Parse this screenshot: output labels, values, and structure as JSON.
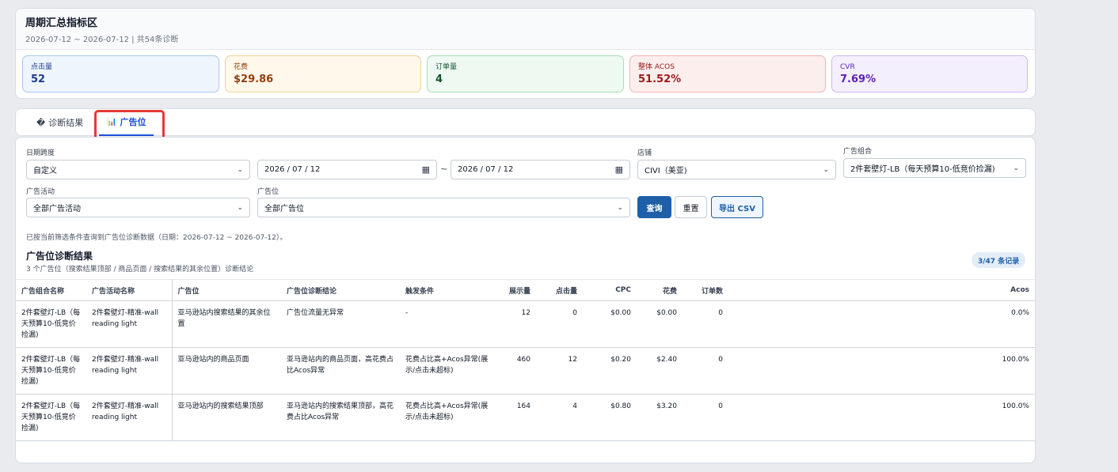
{
  "summary": {
    "title": "周期汇总指标区",
    "subtitle": "2026-07-12 ~ 2026-07-12 | 共54条诊断",
    "kpis": [
      {
        "label": "点击量",
        "value": "52"
      },
      {
        "label": "花费",
        "value": "$29.86"
      },
      {
        "label": "订单量",
        "value": "4"
      },
      {
        "label": "整体 ACOS",
        "value": "51.52%"
      },
      {
        "label": "CVR",
        "value": "7.69%"
      }
    ]
  },
  "tabs": [
    {
      "icon": "�",
      "label": "诊断结果"
    },
    {
      "icon": "📊",
      "label": "广告位"
    }
  ],
  "filters": {
    "date_range": {
      "label": "日期跨度",
      "value": "自定义"
    },
    "date_from": "2026 / 07 / 12",
    "date_sep": "~",
    "date_to": "2026 / 07 / 12",
    "store": {
      "label": "店铺",
      "value": "CIVI（美亚)"
    },
    "ad_group": {
      "label": "广告组合",
      "value": "2件套壁灯-LB（每天预算10-低竞价捡漏)"
    },
    "campaign": {
      "label": "广告活动",
      "value": "全部广告活动"
    },
    "placement": {
      "label": "广告位",
      "value": "全部广告位"
    }
  },
  "buttons": {
    "query": "查询",
    "reset": "重置",
    "export": "导出 CSV"
  },
  "note": "已按当前筛选条件查询到广告位诊断数据（日期：2026-07-12 ~ 2026-07-12）。",
  "results": {
    "title": "广告位诊断结果",
    "subtitle": "3 个广告位（搜索结果顶部 / 商品页面 / 搜索结果的其余位置）诊断结论",
    "badge": "3/47 条记录"
  },
  "table": {
    "columns": [
      "广告组合名称",
      "广告活动名称",
      "广告位",
      "广告位诊断结论",
      "触发条件",
      "展示量",
      "点击量",
      "CPC",
      "花费",
      "订单数",
      "Acos"
    ],
    "rows": [
      [
        "2件套壁灯-LB（每天预算10-低竞价捡漏)",
        "2件套壁灯-精准-wall reading light",
        "亚马逊站内搜索结果的其余位置",
        "广告位流量无异常",
        "-",
        "12",
        "0",
        "$0.00",
        "$0.00",
        "0",
        "0.0%"
      ],
      [
        "2件套壁灯-LB（每天预算10-低竞价捡漏)",
        "2件套壁灯-精准-wall reading light",
        "亚马逊站内的商品页面",
        "亚马逊站内的商品页面，高花费占比Acos异常",
        "花费占比高+Acos异常(展示/点击未超标)",
        "460",
        "12",
        "$0.20",
        "$2.40",
        "0",
        "100.0%"
      ],
      [
        "2件套壁灯-LB（每天预算10-低竞价捡漏)",
        "2件套壁灯-精准-wall reading light",
        "亚马逊站内的搜索结果顶部",
        "亚马逊站内的搜索结果顶部，高花费占比Acos异常",
        "花费占比高+Acos异常(展示/点击未超标)",
        "164",
        "4",
        "$0.80",
        "$3.20",
        "0",
        "100.0%"
      ]
    ]
  },
  "colors": {
    "accent": "#1e5fa8",
    "kpi_clicks": "#1e3a8a",
    "kpi_spend": "#92400e",
    "kpi_orders": "#14532d",
    "kpi_acos": "#991b1b",
    "kpi_cvr": "#5b21b6",
    "highlight": "#e53935"
  }
}
